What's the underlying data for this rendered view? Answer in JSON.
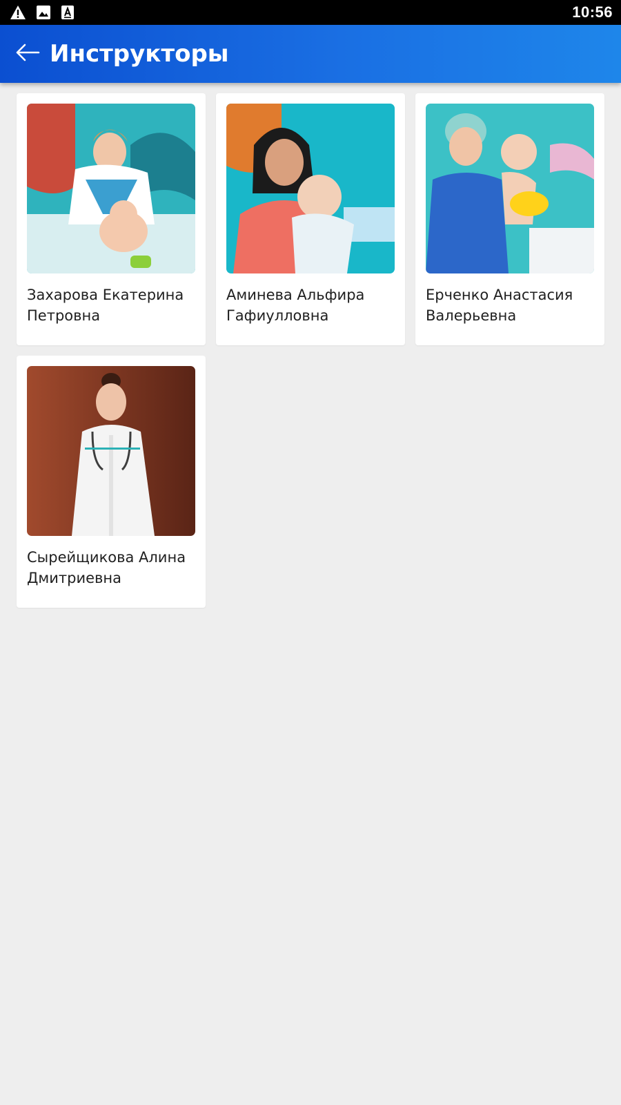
{
  "status_bar": {
    "time": "10:56",
    "icons": [
      "warning-icon",
      "image-icon",
      "text-a-icon"
    ]
  },
  "app_bar": {
    "title": "Инструкторы",
    "back_icon": "arrow-left-icon"
  },
  "colors": {
    "app_bar_start": "#0b4fd1",
    "app_bar_end": "#1e86ea",
    "background": "#eeeeee",
    "card": "#ffffff"
  },
  "instructors": [
    {
      "name": "Захарова Екатерина Петровна",
      "photo": "instructor-bathing-baby-photo"
    },
    {
      "name": "Аминева Альфира Гафиулловна",
      "photo": "instructor-holding-baby-photo"
    },
    {
      "name": "Ерченко Анастасия Валерьевна",
      "photo": "instructor-holding-baby-photo"
    },
    {
      "name": "Сырейщикова Алина Дмитриевна",
      "photo": "instructor-in-white-coat-photo"
    }
  ]
}
